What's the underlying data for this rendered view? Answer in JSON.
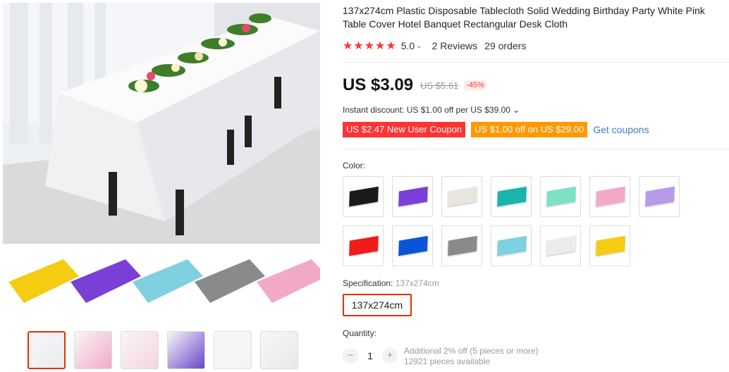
{
  "product": {
    "title": "137x274cm Plastic Disposable Tablecloth Solid Wedding Birthday Party White Pink Table Cover Hotel Banquet Rectangular Desk Cloth",
    "stars": "★★★★★",
    "rating_value": 5.0,
    "rating": "5.0",
    "reviews": "2 Reviews",
    "orders": "29 orders"
  },
  "pricing": {
    "price": "US $3.09",
    "old_price": "US $5.61",
    "discount": "-45%",
    "instant_discount": "Instant discount: US $1.00 off per US $39.00 ⌄",
    "coupon_new_user": "US $2.47 New User Coupon",
    "coupon_store": "US $1.00 off on US $29.00",
    "get_coupons": "Get coupons"
  },
  "options": {
    "color_label": "Color:",
    "colors": [
      "#1a1a1a",
      "#7a3fd6",
      "#e8e6dc",
      "#1ab3ad",
      "#7fe0c8",
      "#f2a9c8",
      "#b79be8",
      "#f21b1b",
      "#0a55d6",
      "#8a8a8a",
      "#7fd0e0",
      "#ececec",
      "#f5cc12"
    ],
    "spec_label": "Specification:",
    "spec_value": "137x274cm",
    "spec_option": "137x274cm"
  },
  "quantity": {
    "label": "Quantity:",
    "minus": "−",
    "value": "1",
    "plus": "+",
    "additional": "Additional 2% off (5 pieces or more)",
    "available": "12921 pieces available"
  },
  "gallery": {
    "strip_colors": [
      "#f5cc12",
      "#7a3fd6",
      "#7fd0e0",
      "#8a8a8a",
      "#f2a9c8"
    ],
    "thumbnail_count": 6
  }
}
